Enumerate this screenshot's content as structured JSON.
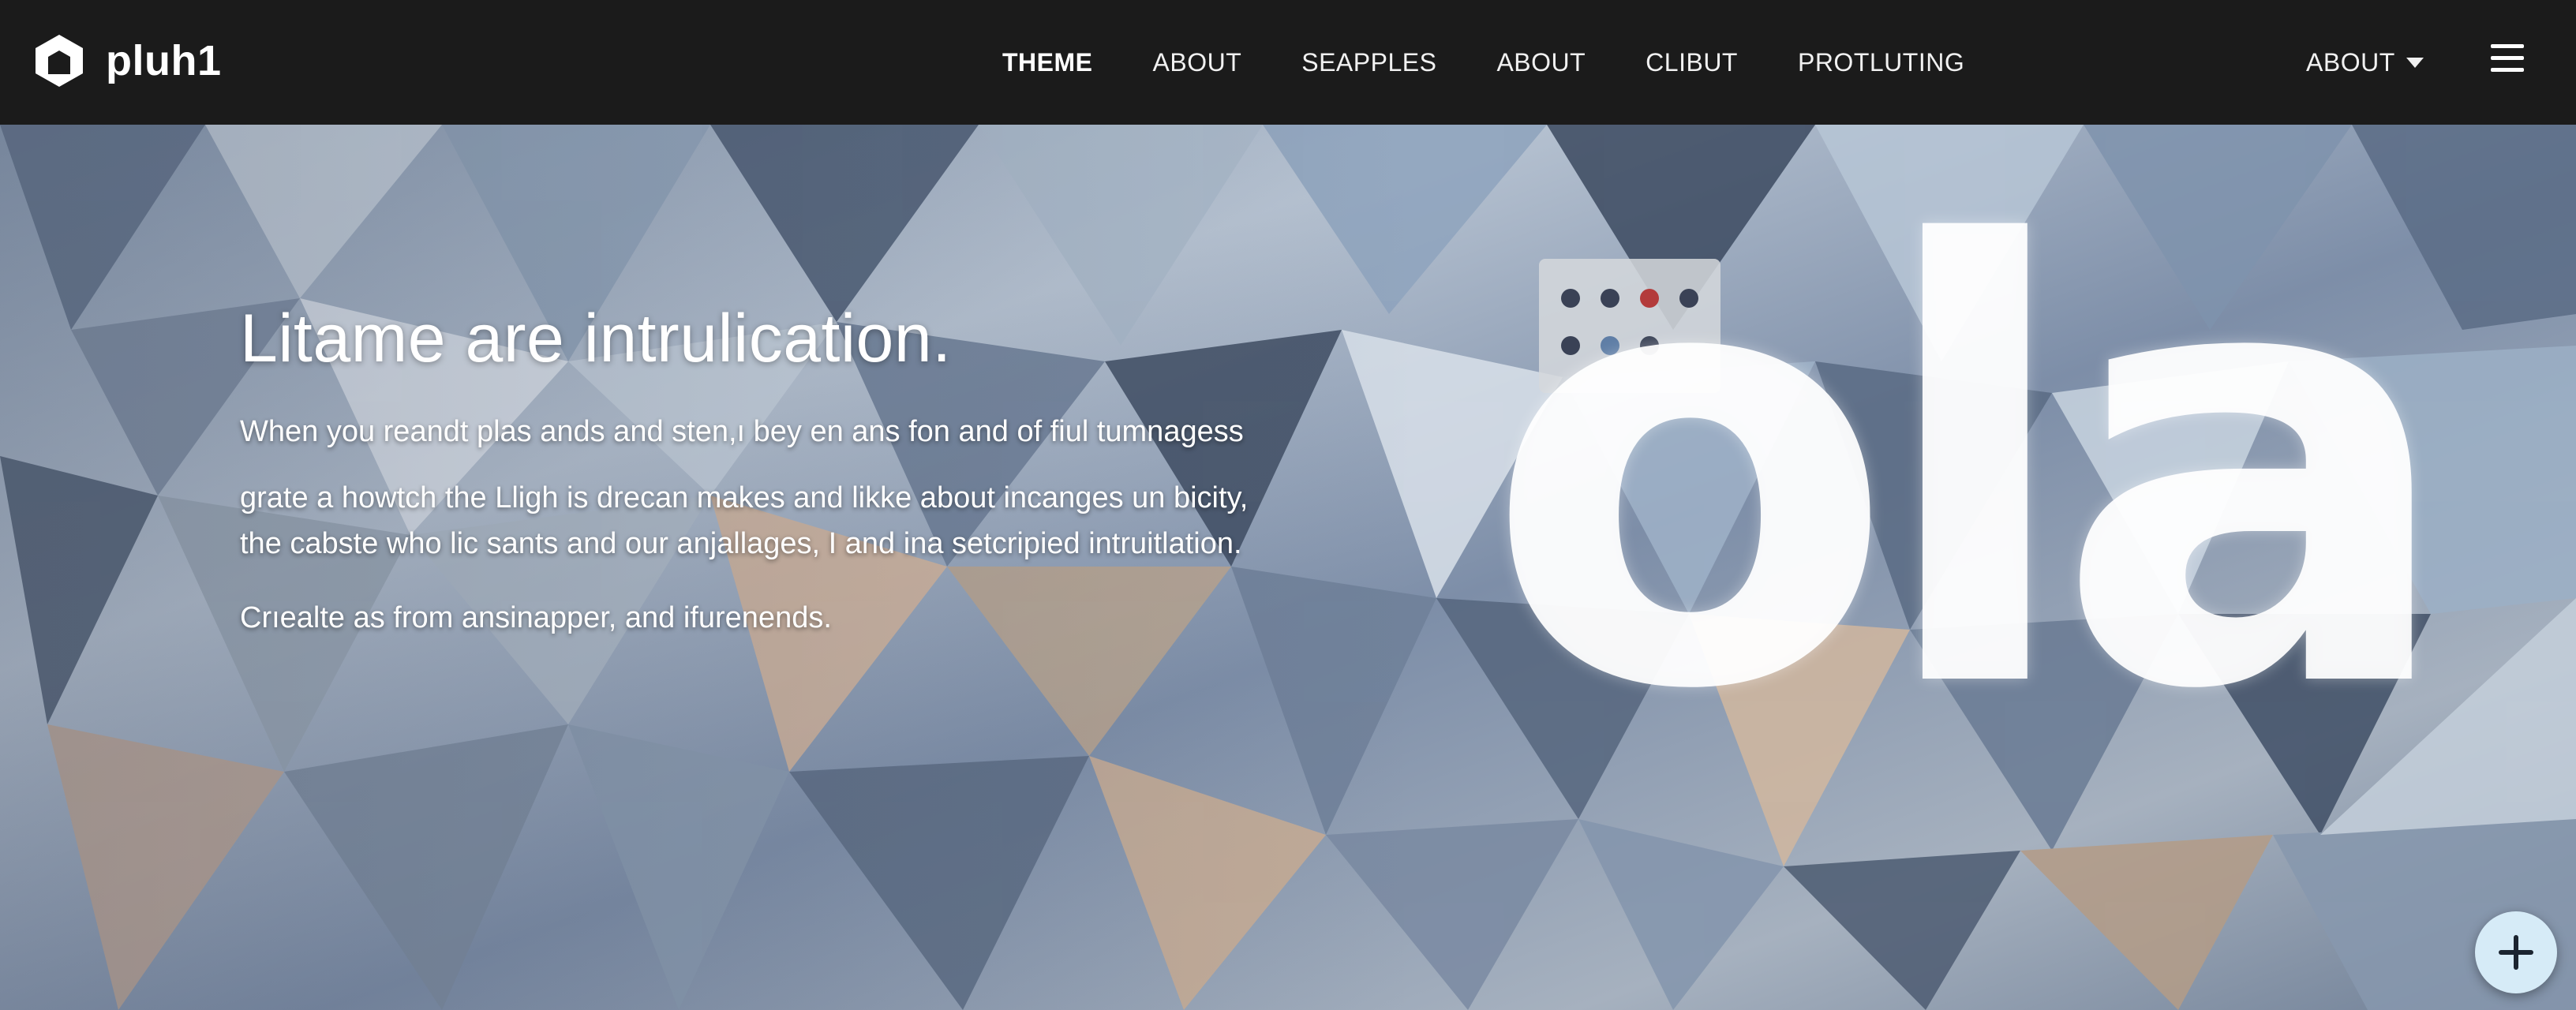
{
  "brand": {
    "name": "pluh1",
    "logo_icon": "hexagon-logo-icon"
  },
  "nav": {
    "links": [
      "THEME",
      "ABOUT",
      "SEAPPLES",
      "ABOUT",
      "CLIBUT",
      "PROTLUTING"
    ],
    "active_index": 0,
    "dropdown_label": "ABOUT",
    "dropdown_icon": "caret-down-icon",
    "menu_icon": "hamburger-menu-icon"
  },
  "hero": {
    "title": "Litame are intrulication.",
    "line1": "When you reandt plas ands and sten,ı bey en ans fon and of fiul tumnagess",
    "line2": "grate a howtch the Lligh is drecan makes and likke about incanges un bicity,",
    "line3": "the cabste who lic sants and our anjallages, I and ina setcripied intruitlation.",
    "line4": "Crıealte as from ansinapper, and ifurenends.",
    "big_word": "ola"
  },
  "fab": {
    "icon": "plus-icon"
  },
  "colors": {
    "navbar": "#1b1b1b",
    "fab": "#d6ebf7",
    "text": "#ffffff"
  }
}
